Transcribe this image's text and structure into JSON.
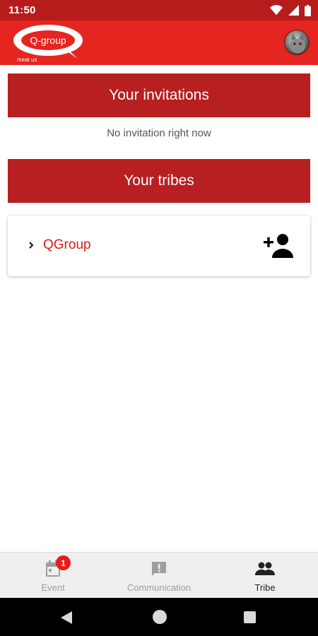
{
  "status_bar": {
    "time": "11:50",
    "icons": [
      "wifi-icon",
      "cellular-signal-icon",
      "battery-icon"
    ]
  },
  "app_bar": {
    "logo_text": "Q-group",
    "logo_tagline": "meat us",
    "avatar": "profile-avatar"
  },
  "invitations": {
    "title": "Your invitations",
    "empty_text": "No invitation right now"
  },
  "tribes": {
    "title": "Your tribes",
    "items": [
      {
        "name": "QGroup",
        "expand_icon": "chevron-right-icon",
        "action_icon": "person-add-icon"
      }
    ]
  },
  "bottom_nav": {
    "items": [
      {
        "label": "Event",
        "icon": "calendar-icon",
        "badge": "1",
        "active": false
      },
      {
        "label": "Communication",
        "icon": "feedback-icon",
        "active": false
      },
      {
        "label": "Tribe",
        "icon": "people-icon",
        "active": true
      }
    ]
  },
  "system_nav": {
    "buttons": [
      "back-button",
      "home-button",
      "recents-button"
    ]
  },
  "colors": {
    "status_bar": "#b71c1c",
    "app_bar": "#e52520",
    "section_header": "#b81f20",
    "tribe_name": "#d32020",
    "badge": "#e81b1b",
    "nav_background": "#efefef"
  }
}
